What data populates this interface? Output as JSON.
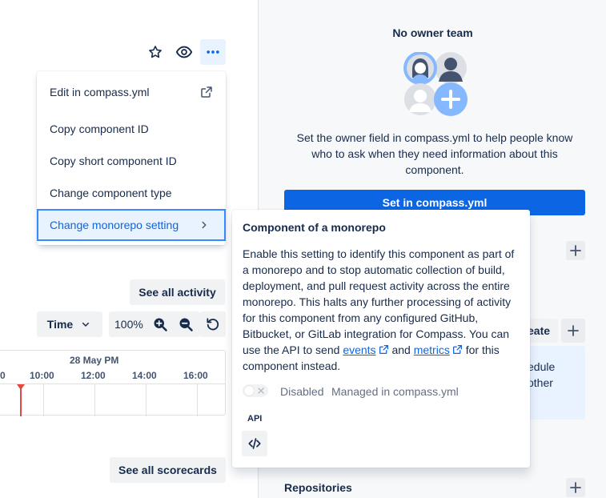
{
  "header_actions": {
    "star_icon": "star-icon",
    "watch_icon": "eye-icon",
    "more_icon": "more-horizontal-icon"
  },
  "menu": {
    "items": [
      {
        "label": "Edit in compass.yml",
        "icon": "external-link-icon"
      },
      {
        "label": "Copy component ID"
      },
      {
        "label": "Copy short component ID"
      },
      {
        "label": "Change component type"
      },
      {
        "label": "Change monorepo setting",
        "icon": "chevron-right-icon"
      }
    ]
  },
  "activity": {
    "see_all_label": "See all activity",
    "time_select": "Time",
    "zoom_level": "100%",
    "date_label": "28 May PM",
    "ticks": [
      "0",
      "10:00",
      "12:00",
      "14:00",
      "16:00"
    ]
  },
  "scorecards": {
    "see_all_label": "See all scorecards"
  },
  "owner": {
    "title": "No owner team",
    "description": "Set the owner field in compass.yml to help people know who to ask when they need information about this component.",
    "button_label": "Set in compass.yml"
  },
  "right_partial": {
    "create_label": "eate",
    "info_line1": "edule",
    "info_line2": "other",
    "repositories_label": "Repositories"
  },
  "popup": {
    "title": "Component of a monorepo",
    "body_text": "Enable this setting to identify this component as part of a monorepo and to stop automatic collection of build, deployment, and pull request activity across the entire monorepo. This halts any further processing of activity for this component from any configured GitHub, Bitbucket, or GitLab integration for Compass. You can use the API to send",
    "events_link": "events",
    "and_text": "and",
    "metrics_link": "metrics",
    "tail_text": "for this component instead.",
    "toggle_state": "Disabled",
    "managed_text": "Managed in compass.yml",
    "api_label": "API",
    "api_icon": "code-icon"
  },
  "colors": {
    "primary": "#0c66e4",
    "marker": "#e2483d",
    "selected_bg": "#e9f2ff"
  }
}
